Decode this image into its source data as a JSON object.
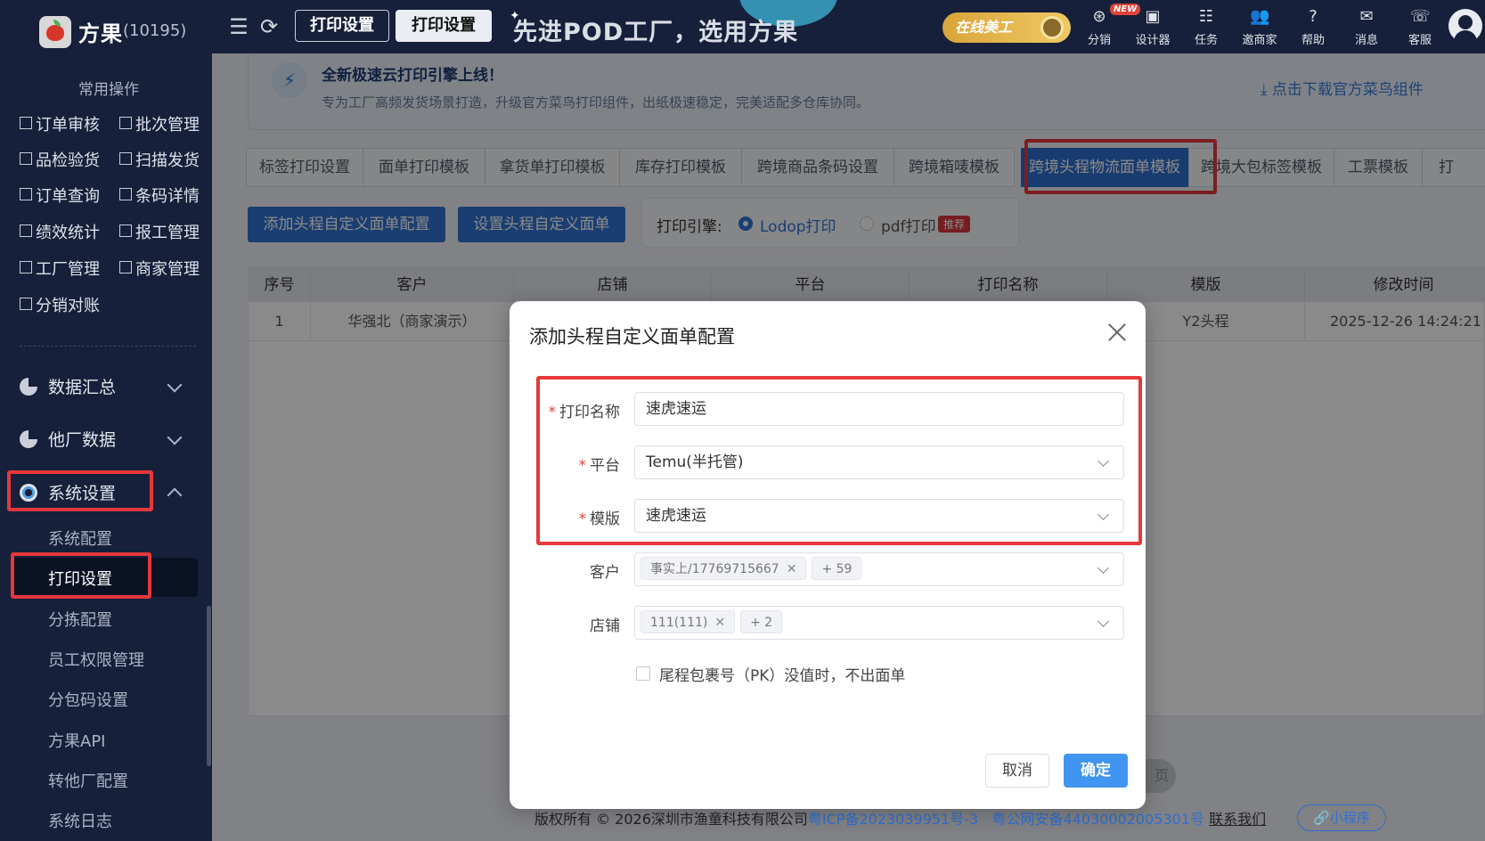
{
  "topbar": {
    "brand": "方果",
    "brand_count": "(10195)",
    "tabs": [
      {
        "label": "打印设置"
      },
      {
        "label": "打印设置"
      }
    ],
    "slogan": "先进POD工厂，选用方果",
    "online_badge": "在线美工",
    "new_badge": "NEW",
    "nav": [
      {
        "label": "分销",
        "icon": "distribution-icon"
      },
      {
        "label": "设计器",
        "icon": "designer-icon"
      },
      {
        "label": "任务",
        "icon": "task-icon"
      },
      {
        "label": "邀商家",
        "icon": "invite-icon"
      },
      {
        "label": "帮助",
        "icon": "help-icon"
      },
      {
        "label": "消息",
        "icon": "message-icon"
      },
      {
        "label": "客服",
        "icon": "customer-service-icon"
      }
    ]
  },
  "sidebar": {
    "heading": "常用操作",
    "quick_actions": [
      {
        "label": "订单审核"
      },
      {
        "label": "批次管理"
      },
      {
        "label": "品检验货"
      },
      {
        "label": "扫描发货"
      },
      {
        "label": "订单查询"
      },
      {
        "label": "条码详情"
      },
      {
        "label": "绩效统计"
      },
      {
        "label": "报工管理"
      },
      {
        "label": "工厂管理"
      },
      {
        "label": "商家管理"
      },
      {
        "label": "分销对账"
      }
    ],
    "groups": [
      {
        "label": "数据汇总"
      },
      {
        "label": "他厂数据"
      },
      {
        "label": "系统设置"
      }
    ],
    "sub_items": [
      {
        "label": "系统配置"
      },
      {
        "label": "打印设置"
      },
      {
        "label": "分拣配置"
      },
      {
        "label": "员工权限管理"
      },
      {
        "label": "分包码设置"
      },
      {
        "label": "方果API"
      },
      {
        "label": "转他厂配置"
      },
      {
        "label": "系统日志"
      }
    ]
  },
  "notice": {
    "title": "全新极速云打印引擎上线！",
    "desc": "专为工厂高频发货场景打造，升级官方菜鸟打印组件，出纸极速稳定，完美适配多仓库协同。",
    "download": "点击下载官方菜鸟组件"
  },
  "tabs": [
    {
      "label": "标签打印设置"
    },
    {
      "label": "面单打印模板"
    },
    {
      "label": "拿货单打印模板"
    },
    {
      "label": "库存打印模板"
    },
    {
      "label": "跨境商品条码设置"
    },
    {
      "label": "跨境箱唛模板"
    },
    {
      "label": "跨境头程物流面单模板"
    },
    {
      "label": "跨境大包标签模板"
    },
    {
      "label": "工票模板"
    },
    {
      "label": "打"
    }
  ],
  "actions": {
    "add_btn": "添加头程自定义面单配置",
    "set_btn": "设置头程自定义面单",
    "engine_label": "打印引擎:",
    "engine_opt1": "Lodop打印",
    "engine_opt2": "pdf打印",
    "engine_recommend": "推荐"
  },
  "table": {
    "headers": [
      "序号",
      "客户",
      "店铺",
      "平台",
      "打印名称",
      "模版",
      "修改时间"
    ],
    "rows": [
      [
        "1",
        "华强北（商家演示）",
        "",
        "",
        "",
        "Y2头程",
        "2025-12-26 14:24:21"
      ]
    ]
  },
  "pager_hint": "页",
  "footer": {
    "copyright": "版权所有 © 2026深圳市渔童科技有限公司",
    "icp": "粤ICP备2023039951号-3",
    "police": "粤公网安备44030002005301号",
    "contact": "联系我们",
    "mini": "小程序"
  },
  "modal": {
    "title": "添加头程自定义面单配置",
    "fields": {
      "print_name_label": "打印名称",
      "print_name_value": "速虎速运",
      "platform_label": "平台",
      "platform_value": "Temu(半托管)",
      "template_label": "模版",
      "template_value": "速虎速运",
      "customer_label": "客户",
      "customer_tag": "事实上/17769715667",
      "customer_more": "+ 59",
      "store_label": "店铺",
      "store_tag": "111(111)",
      "store_more": "+ 2"
    },
    "checkbox_label": "尾程包裹号（PK）没值时，不出面单",
    "cancel": "取消",
    "ok": "确定"
  },
  "colors": {
    "sidebar_bg": "#16203a",
    "primary": "#3073d1",
    "highlight_red": "#e5383b",
    "ok_button": "#3f95f0"
  }
}
